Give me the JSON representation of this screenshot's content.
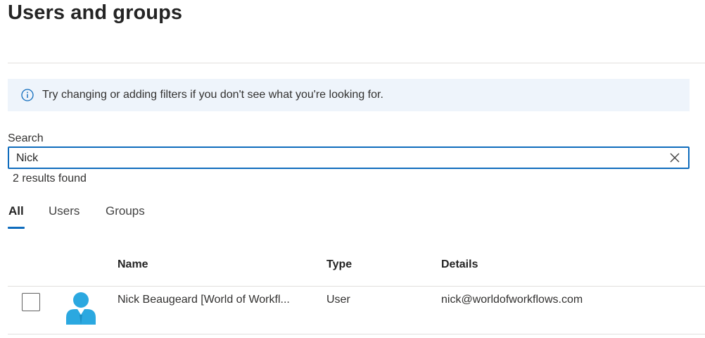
{
  "page": {
    "title": "Users and groups"
  },
  "info_bar": {
    "icon": "info-icon",
    "message": "Try changing or adding filters if you don't see what you're looking for."
  },
  "search": {
    "label": "Search",
    "value": "Nick",
    "placeholder": "",
    "clear_icon": "close-icon",
    "results_text": "2 results found"
  },
  "tabs": [
    {
      "label": "All",
      "active": true
    },
    {
      "label": "Users",
      "active": false
    },
    {
      "label": "Groups",
      "active": false
    }
  ],
  "table": {
    "columns": [
      "Name",
      "Type",
      "Details"
    ],
    "rows": [
      {
        "selected": false,
        "avatar_icon": "user-avatar-icon",
        "name": "Nick Beaugeard [World of Workfl...",
        "type": "User",
        "details": "nick@worldofworkflows.com"
      }
    ]
  },
  "colors": {
    "accent": "#0f6cbd",
    "info_background": "#eef4fb",
    "avatar": "#2ba8e0"
  }
}
